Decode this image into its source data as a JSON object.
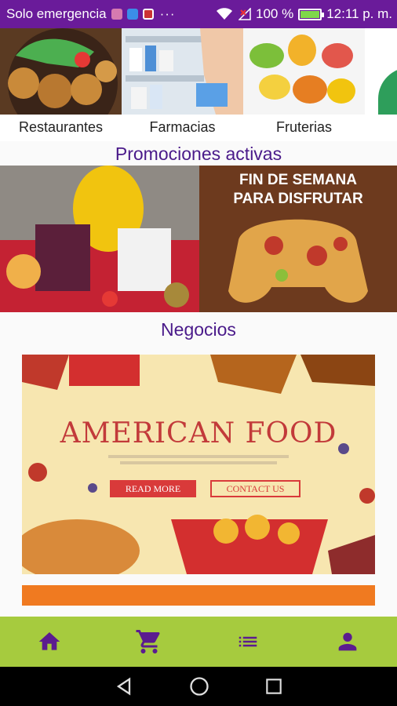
{
  "status_bar": {
    "carrier": "Solo emergencia",
    "dots": "···",
    "battery_text": "100 %",
    "battery_level": 1.0,
    "time": "12:11 p. m."
  },
  "categories": [
    {
      "label": "Restaurantes",
      "icon": "restaurant-image"
    },
    {
      "label": "Farmacias",
      "icon": "pharmacy-image"
    },
    {
      "label": "Fruterias",
      "icon": "fruit-image"
    }
  ],
  "promotions": {
    "title": "Promociones activas",
    "items": [
      {
        "name": "smoothie-promo",
        "text": ""
      },
      {
        "name": "pizza-promo",
        "text": "FIN DE SEMANA PARA DISFRUTAR"
      }
    ]
  },
  "business": {
    "title": "Negocios",
    "banner": {
      "headline": "AMERICAN FOOD",
      "read_more": "READ MORE",
      "contact_us": "CONTACT US"
    }
  },
  "bottom_nav": {
    "items": [
      "home-icon",
      "cart-icon",
      "list-icon",
      "person-icon"
    ]
  },
  "colors": {
    "status_bar": "#6a1b9a",
    "accent_purple": "#4a1a8a",
    "bottom_nav": "#a6cb3e"
  }
}
